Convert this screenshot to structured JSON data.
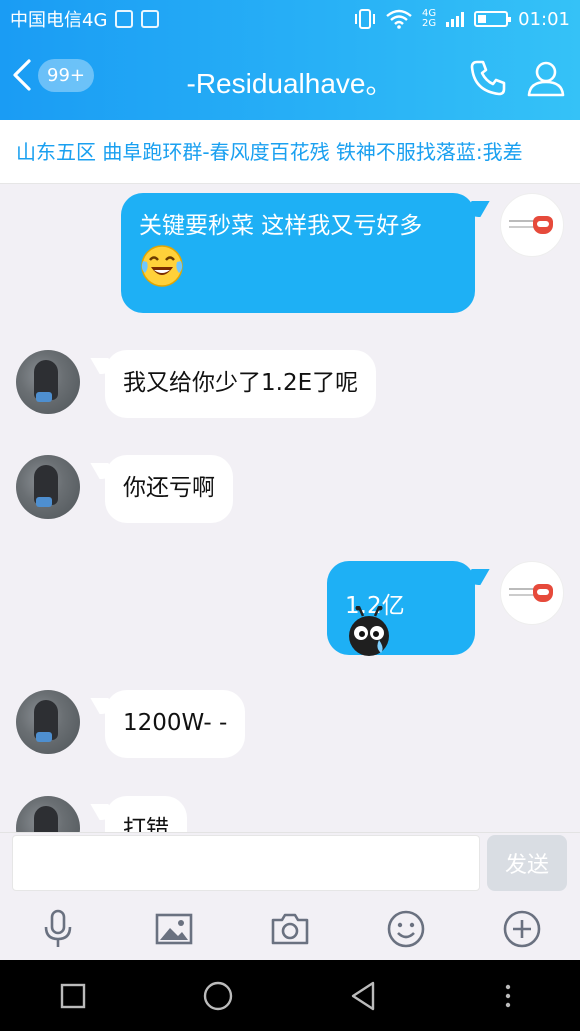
{
  "status": {
    "carrier": "中国电信4G",
    "net_top": "4G",
    "net_bottom": "2G",
    "time": "01:01"
  },
  "header": {
    "unread_badge": "99+",
    "title": "-Residualhave。"
  },
  "marquee": {
    "text": "山东五区  曲阜跑环群-春风度百花残  铁神不服找落蓝:我差"
  },
  "messages": [
    {
      "side": "right",
      "text": "关键要秒菜 这样我又亏好多",
      "emoji": "tears-of-joy"
    },
    {
      "side": "left",
      "text": "我又给你少了1.2E了呢"
    },
    {
      "side": "left",
      "text": "你还亏啊"
    },
    {
      "side": "right",
      "text": "1.2亿",
      "emoji": "crying-bug"
    },
    {
      "side": "left",
      "text": "1200W- -"
    },
    {
      "side": "left",
      "text": "打错"
    }
  ],
  "input": {
    "value": "",
    "send_label": "发送"
  },
  "colors": {
    "header_blue": "#1a9cf4",
    "bubble_blue": "#1eb0f5",
    "marquee_text": "#1aa0f0"
  }
}
